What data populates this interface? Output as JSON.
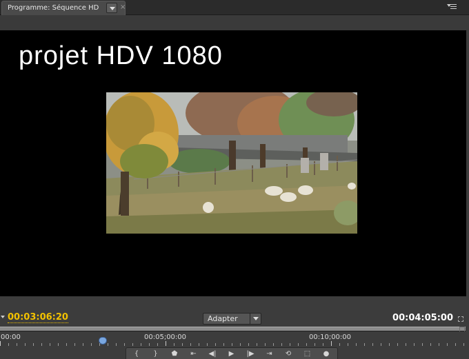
{
  "tab": {
    "label": "Programme: Séquence HD",
    "close_glyph": "×"
  },
  "monitor": {
    "title_overlay": "projet HDV 1080"
  },
  "controls": {
    "current_timecode": "00:03:06:20",
    "fit_select_value": "Adapter",
    "duration_timecode": "00:04:05:00"
  },
  "ruler": {
    "labels": [
      "00:00",
      "00:05;00:00",
      "00:10;00:00"
    ],
    "playhead_position_fraction": 0.22
  },
  "transport": {
    "buttons": [
      {
        "name": "mark-in-icon",
        "glyph": "{"
      },
      {
        "name": "mark-out-icon",
        "glyph": "}"
      },
      {
        "name": "set-marker-icon",
        "glyph": "⬟"
      },
      {
        "name": "go-to-in-point-icon",
        "glyph": "⇤"
      },
      {
        "name": "step-back-icon",
        "glyph": "◀|"
      },
      {
        "name": "play-icon",
        "glyph": "▶"
      },
      {
        "name": "step-forward-icon",
        "glyph": "|▶"
      },
      {
        "name": "go-to-out-point-icon",
        "glyph": "⇥"
      },
      {
        "name": "loop-icon",
        "glyph": "⟲"
      },
      {
        "name": "safe-margins-icon",
        "glyph": "⬚"
      },
      {
        "name": "export-frame-icon",
        "glyph": "●"
      }
    ]
  },
  "colors": {
    "current_timecode": "#f2c100",
    "playhead": "#7aa7e0"
  }
}
